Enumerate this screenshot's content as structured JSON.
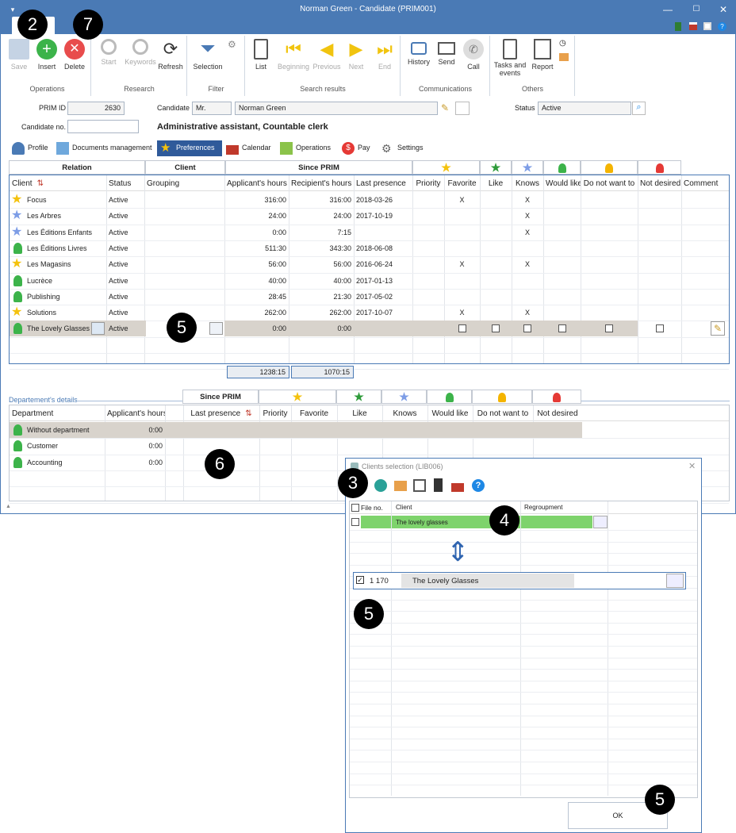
{
  "window": {
    "title": "Norman Green - Candidate (PRIM001)"
  },
  "ribbon": {
    "operations": {
      "label": "Operations",
      "save": "Save",
      "insert": "Insert",
      "delete": "Delete"
    },
    "research": {
      "label": "Research",
      "start": "Start",
      "keywords": "Keywords",
      "refresh": "Refresh"
    },
    "filter": {
      "label": "Filter",
      "selection": "Selection"
    },
    "search_results": {
      "label": "Search results",
      "list": "List",
      "beginning": "Beginning",
      "previous": "Previous",
      "next": "Next",
      "end": "End"
    },
    "communications": {
      "label": "Communications",
      "history": "History",
      "send": "Send",
      "call": "Call"
    },
    "others": {
      "label": "Others",
      "tasks": "Tasks and events",
      "report": "Report"
    }
  },
  "form": {
    "prim_id_label": "PRIM ID",
    "prim_id": "2630",
    "candidate_label": "Candidate",
    "title": "Mr.",
    "candidate_name": "Norman Green",
    "status_label": "Status",
    "status": "Active",
    "candidate_no_label": "Candidate no.",
    "candidate_no": "",
    "job": "Administrative assistant, Countable clerk"
  },
  "tabs": [
    "Profile",
    "Documents management",
    "Preferences",
    "Calendar",
    "Operations",
    "Pay",
    "Settings"
  ],
  "relation_grid": {
    "group_headers": {
      "relation": "Relation",
      "client": "Client",
      "since_prim": "Since PRIM"
    },
    "columns": [
      "Client",
      "Status",
      "Grouping",
      "Applicant's hours",
      "Recipient's hours",
      "Last presence",
      "Priority",
      "Favorite",
      "Like",
      "Knows",
      "Would like",
      "Do not want to",
      "Not desired",
      "Comment"
    ],
    "rows": [
      {
        "icon": "star-gold",
        "client": "Focus",
        "status": "Active",
        "app": "316:00",
        "rec": "316:00",
        "last": "2018-03-26",
        "fav": "X",
        "like": "",
        "knows": "X"
      },
      {
        "icon": "star-blue",
        "client": "Les Arbres",
        "status": "Active",
        "app": "24:00",
        "rec": "24:00",
        "last": "2017-10-19",
        "fav": "",
        "like": "",
        "knows": "X"
      },
      {
        "icon": "star-blue",
        "client": "Les Éditions Enfants",
        "status": "Active",
        "app": "0:00",
        "rec": "7:15",
        "last": "",
        "fav": "",
        "like": "",
        "knows": "X"
      },
      {
        "icon": "person-green",
        "client": "Les Éditions Livres",
        "status": "Active",
        "app": "511:30",
        "rec": "343:30",
        "last": "2018-06-08",
        "fav": "",
        "like": "",
        "knows": ""
      },
      {
        "icon": "star-gold",
        "client": "Les Magasins",
        "status": "Active",
        "app": "56:00",
        "rec": "56:00",
        "last": "2016-06-24",
        "fav": "X",
        "like": "",
        "knows": "X"
      },
      {
        "icon": "person-green",
        "client": "Lucrèce",
        "status": "Active",
        "app": "40:00",
        "rec": "40:00",
        "last": "2017-01-13",
        "fav": "",
        "like": "",
        "knows": ""
      },
      {
        "icon": "person-green",
        "client": "Publishing",
        "status": "Active",
        "app": "28:45",
        "rec": "21:30",
        "last": "2017-05-02",
        "fav": "",
        "like": "",
        "knows": ""
      },
      {
        "icon": "star-gold",
        "client": "Solutions",
        "status": "Active",
        "app": "262:00",
        "rec": "262:00",
        "last": "2017-10-07",
        "fav": "X",
        "like": "",
        "knows": "X"
      },
      {
        "icon": "person-green",
        "client": "The Lovely Glasses",
        "status": "Active",
        "app": "0:00",
        "rec": "0:00",
        "last": "",
        "fav": "",
        "like": "",
        "knows": ""
      }
    ],
    "totals": {
      "app": "1238:15",
      "rec": "1070:15"
    }
  },
  "dept_grid": {
    "section_label": "Departement's details",
    "since_prim": "Since PRIM",
    "columns": [
      "Department",
      "Applicant's hours",
      "Last presence",
      "Priority",
      "Favorite",
      "Like",
      "Knows",
      "Would like",
      "Do not want to",
      "Not desired"
    ],
    "rows": [
      {
        "dept": "Without department",
        "hours": "0:00"
      },
      {
        "dept": "Customer",
        "hours": "0:00"
      },
      {
        "dept": "Accounting",
        "hours": "0:00"
      }
    ]
  },
  "dialog": {
    "title": "Clients selection (LIB006)",
    "columns": [
      "File no.",
      "Client",
      "Regroupment"
    ],
    "filter_value": "The lovely glasses",
    "result_file_no": "1 170",
    "result_client": "The Lovely Glasses",
    "ok": "OK"
  },
  "callouts": {
    "b2": "2",
    "b7": "7",
    "b3": "3",
    "b4": "4",
    "b5a": "5",
    "b5b": "5",
    "b5c": "5",
    "b6": "6"
  },
  "colors": {
    "accent": "#4a7ab5",
    "selected_row": "#d8d3cc",
    "green_filter": "#7ed36c"
  }
}
